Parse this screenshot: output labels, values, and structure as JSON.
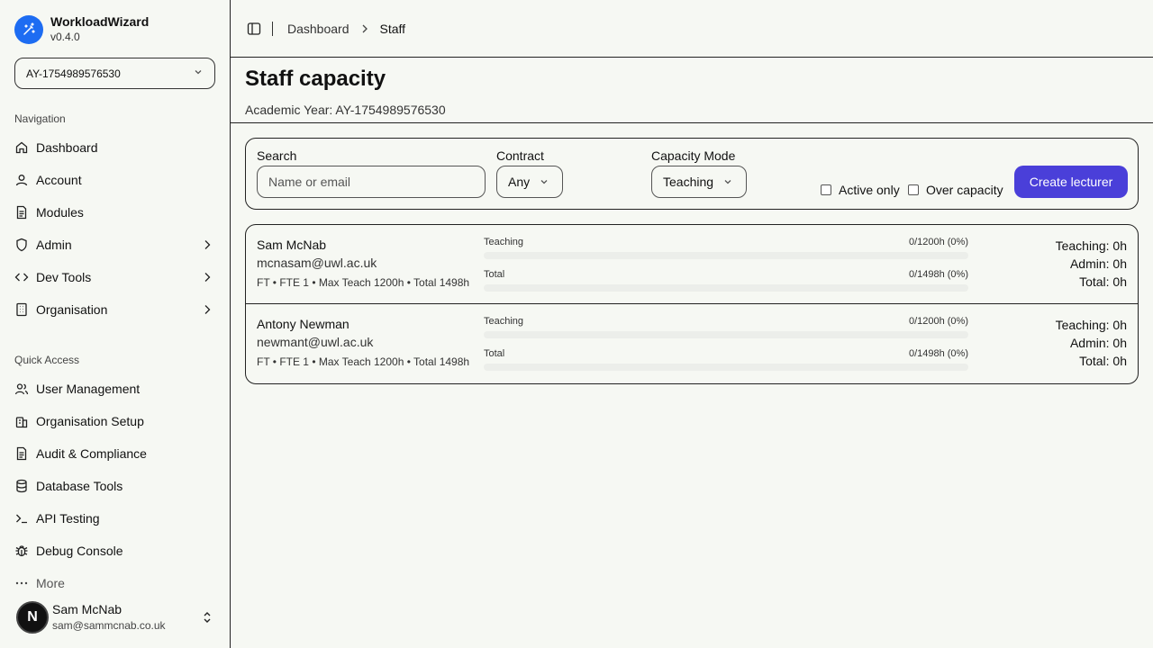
{
  "app": {
    "name": "WorkloadWizard",
    "version": "v0.4.0"
  },
  "academic_year_select": {
    "value": "AY-1754989576530"
  },
  "sidebar": {
    "nav_title": "Navigation",
    "nav_items": [
      {
        "label": "Dashboard",
        "icon": "home-icon"
      },
      {
        "label": "Account",
        "icon": "user-icon"
      },
      {
        "label": "Modules",
        "icon": "document-icon"
      },
      {
        "label": "Admin",
        "icon": "shield-icon"
      },
      {
        "label": "Dev Tools",
        "icon": "code-icon"
      },
      {
        "label": "Organisation",
        "icon": "building-icon"
      }
    ],
    "quick_title": "Quick Access",
    "quick_items": [
      {
        "label": "User Management",
        "icon": "users-icon"
      },
      {
        "label": "Organisation Setup",
        "icon": "building-icon"
      },
      {
        "label": "Audit & Compliance",
        "icon": "document-icon"
      },
      {
        "label": "Database Tools",
        "icon": "database-icon"
      },
      {
        "label": "API Testing",
        "icon": "terminal-icon"
      },
      {
        "label": "Debug Console",
        "icon": "bug-icon"
      },
      {
        "label": "More",
        "icon": "more-icon"
      }
    ],
    "user": {
      "name": "Sam McNab",
      "email": "sam@sammcnab.co.uk",
      "avatar_letter": "N"
    }
  },
  "breadcrumb": {
    "parent": "Dashboard",
    "current": "Staff"
  },
  "page": {
    "title": "Staff capacity",
    "subtitle": "Academic Year: AY-1754989576530"
  },
  "filters": {
    "search_label": "Search",
    "search_placeholder": "Name or email",
    "contract_label": "Contract",
    "contract_value": "Any",
    "capacity_label": "Capacity Mode",
    "capacity_value": "Teaching",
    "active_only_label": "Active only",
    "over_capacity_label": "Over capacity",
    "create_button": "Create lecturer"
  },
  "staff": [
    {
      "name": "Sam McNab",
      "email": "mcnasam@uwl.ac.uk",
      "meta": "FT • FTE 1 • Max Teach 1200h • Total 1498h",
      "teaching_label": "Teaching",
      "teaching_value": "0/1200h (0%)",
      "teaching_fraction": 0,
      "total_label": "Total",
      "total_value": "0/1498h (0%)",
      "total_fraction": 0,
      "sum_teaching": "Teaching: 0h",
      "sum_admin": "Admin: 0h",
      "sum_total": "Total: 0h"
    },
    {
      "name": "Antony Newman",
      "email": "newmant@uwl.ac.uk",
      "meta": "FT • FTE 1 • Max Teach 1200h • Total 1498h",
      "teaching_label": "Teaching",
      "teaching_value": "0/1200h (0%)",
      "teaching_fraction": 0,
      "total_label": "Total",
      "total_value": "0/1498h (0%)",
      "total_fraction": 0,
      "sum_teaching": "Teaching: 0h",
      "sum_admin": "Admin: 0h",
      "sum_total": "Total: 0h"
    }
  ],
  "colors": {
    "accent": "#4a3fd9",
    "brand": "#1d6cf2",
    "background": "#f6f8f3"
  }
}
